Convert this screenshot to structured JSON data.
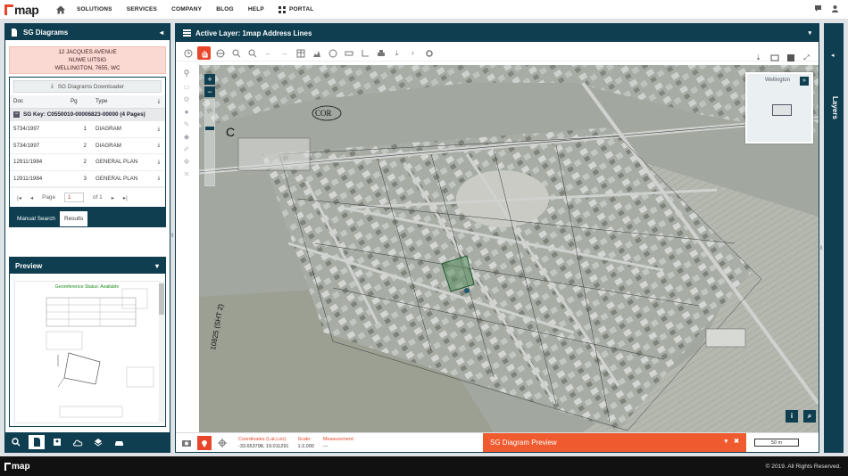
{
  "app": {
    "logo_text": "map",
    "nav": [
      "SOLUTIONS",
      "SERVICES",
      "COMPANY",
      "BLOG",
      "HELP"
    ],
    "portal_label": "PORTAL"
  },
  "left_panel": {
    "title": "SG Diagrams",
    "address_lines": [
      "12 JACQUES AVENUE",
      "NUWE UITSIG",
      "WELLINGTON, 7655, WC"
    ],
    "downloader_label": "SG Diagrams Downloader",
    "columns": [
      "Doc",
      "Pg",
      "Type"
    ],
    "sg_key": "SG Key: C0550010-00006823-00000 (4 Pages)",
    "rows": [
      {
        "doc": "5734/1997",
        "pg": "1",
        "type": "DIAGRAM"
      },
      {
        "doc": "5734/1997",
        "pg": "2",
        "type": "DIAGRAM"
      },
      {
        "doc": "12911/1984",
        "pg": "2",
        "type": "GENERAL PLAN"
      },
      {
        "doc": "12911/1984",
        "pg": "3",
        "type": "GENERAL PLAN"
      }
    ],
    "pager": {
      "page_label": "Page",
      "page_value": "1",
      "of_label": "of 1"
    },
    "tabs": [
      "Manual Search",
      "Results"
    ],
    "preview_title": "Preview",
    "georeference_status": "Georeference Status: Available"
  },
  "main_panel": {
    "active_layer_label": "Active Layer: 1map Address Lines",
    "overview_label": "Wellington",
    "status": {
      "coords_label": "Coordinates (Lat,Lon):",
      "coords_value": "-33.653798, 19.011291",
      "scale_label": "Scale:",
      "scale_value": "1:2,000",
      "measurement_label": "Measurement:",
      "measurement_value": "---",
      "scalebar_text": "50 m"
    },
    "sg_preview_label": "SG Diagram Preview"
  },
  "layers_label": "Layers",
  "footer": {
    "logo_text": "map",
    "copyright": "© 2019. All Rights Reserved."
  },
  "colors": {
    "brand_dark": "#0e3e4f",
    "accent": "#e8462a",
    "address_bg": "#fbd9d3"
  }
}
